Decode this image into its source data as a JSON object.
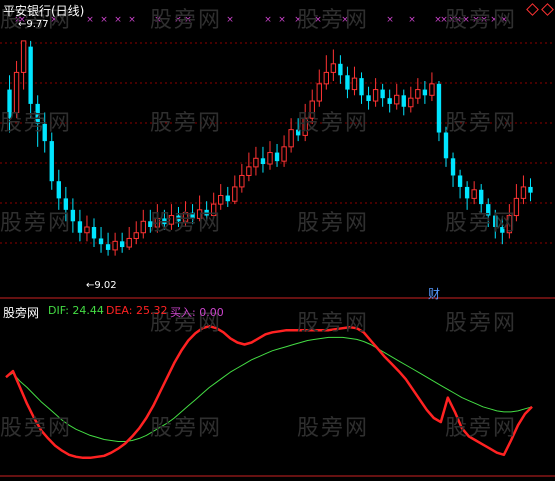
{
  "watermark": "股旁网",
  "main_panel": {
    "title": "平安银行(日线)",
    "high_label": "9.77",
    "low_label": "9.02",
    "event_label": "财",
    "colors": {
      "up": "#ff3333",
      "down": "#00e5ff",
      "grid": "#8b0000",
      "marker": "#cc44cc",
      "text": "#ffffff",
      "event": "#5599ff"
    }
  },
  "indicator_panel": {
    "title": "股旁网",
    "dif_label": "DIF: 24.44",
    "dea_label": "DEA: 25.32",
    "buy_label": "买入: 0.00",
    "colors": {
      "dif": "#44dd44",
      "dea": "#ff2222",
      "buy": "#cc44cc",
      "title": "#ffffff"
    }
  },
  "chart_data": [
    {
      "type": "candlestick",
      "title": "平安银行(日线)",
      "annotations": [
        {
          "text": "9.77",
          "kind": "high"
        },
        {
          "text": "9.02",
          "kind": "low"
        },
        {
          "text": "财",
          "kind": "event"
        }
      ],
      "ylim": [
        8.9,
        9.85
      ],
      "candles": [
        [
          9.6,
          9.5,
          9.65,
          9.45
        ],
        [
          9.52,
          9.66,
          9.7,
          9.5
        ],
        [
          9.66,
          9.77,
          9.77,
          9.6
        ],
        [
          9.75,
          9.55,
          9.77,
          9.5
        ],
        [
          9.55,
          9.48,
          9.58,
          9.4
        ],
        [
          9.48,
          9.42,
          9.52,
          9.38
        ],
        [
          9.42,
          9.28,
          9.45,
          9.25
        ],
        [
          9.28,
          9.22,
          9.32,
          9.18
        ],
        [
          9.22,
          9.18,
          9.26,
          9.14
        ],
        [
          9.18,
          9.14,
          9.22,
          9.1
        ],
        [
          9.14,
          9.1,
          9.18,
          9.07
        ],
        [
          9.1,
          9.12,
          9.16,
          9.07
        ],
        [
          9.12,
          9.08,
          9.15,
          9.05
        ],
        [
          9.08,
          9.06,
          9.12,
          9.03
        ],
        [
          9.06,
          9.04,
          9.1,
          9.02
        ],
        [
          9.04,
          9.07,
          9.1,
          9.02
        ],
        [
          9.07,
          9.05,
          9.1,
          9.03
        ],
        [
          9.05,
          9.08,
          9.12,
          9.04
        ],
        [
          9.08,
          9.1,
          9.14,
          9.06
        ],
        [
          9.1,
          9.14,
          9.18,
          9.08
        ],
        [
          9.14,
          9.12,
          9.18,
          9.1
        ],
        [
          9.12,
          9.15,
          9.2,
          9.1
        ],
        [
          9.15,
          9.13,
          9.18,
          9.11
        ],
        [
          9.13,
          9.16,
          9.2,
          9.11
        ],
        [
          9.16,
          9.14,
          9.19,
          9.12
        ],
        [
          9.14,
          9.17,
          9.21,
          9.12
        ],
        [
          9.17,
          9.15,
          9.2,
          9.13
        ],
        [
          9.15,
          9.18,
          9.23,
          9.14
        ],
        [
          9.18,
          9.16,
          9.21,
          9.14
        ],
        [
          9.16,
          9.2,
          9.24,
          9.15
        ],
        [
          9.2,
          9.23,
          9.27,
          9.18
        ],
        [
          9.23,
          9.21,
          9.26,
          9.19
        ],
        [
          9.21,
          9.26,
          9.3,
          9.2
        ],
        [
          9.26,
          9.3,
          9.34,
          9.24
        ],
        [
          9.3,
          9.33,
          9.38,
          9.28
        ],
        [
          9.33,
          9.36,
          9.4,
          9.3
        ],
        [
          9.36,
          9.34,
          9.4,
          9.31
        ],
        [
          9.34,
          9.38,
          9.42,
          9.32
        ],
        [
          9.38,
          9.35,
          9.41,
          9.33
        ],
        [
          9.35,
          9.4,
          9.44,
          9.33
        ],
        [
          9.4,
          9.46,
          9.5,
          9.38
        ],
        [
          9.46,
          9.44,
          9.5,
          9.42
        ],
        [
          9.44,
          9.5,
          9.55,
          9.42
        ],
        [
          9.5,
          9.56,
          9.6,
          9.48
        ],
        [
          9.56,
          9.62,
          9.67,
          9.54
        ],
        [
          9.62,
          9.66,
          9.72,
          9.6
        ],
        [
          9.66,
          9.69,
          9.74,
          9.63
        ],
        [
          9.69,
          9.65,
          9.72,
          9.62
        ],
        [
          9.65,
          9.6,
          9.68,
          9.57
        ],
        [
          9.6,
          9.64,
          9.68,
          9.58
        ],
        [
          9.64,
          9.58,
          9.66,
          9.55
        ],
        [
          9.58,
          9.56,
          9.61,
          9.53
        ],
        [
          9.56,
          9.6,
          9.64,
          9.54
        ],
        [
          9.6,
          9.57,
          9.62,
          9.54
        ],
        [
          9.57,
          9.55,
          9.6,
          9.52
        ],
        [
          9.55,
          9.58,
          9.62,
          9.53
        ],
        [
          9.58,
          9.54,
          9.6,
          9.51
        ],
        [
          9.54,
          9.57,
          9.61,
          9.52
        ],
        [
          9.57,
          9.6,
          9.64,
          9.55
        ],
        [
          9.6,
          9.58,
          9.63,
          9.55
        ],
        [
          9.58,
          9.62,
          9.66,
          9.56
        ],
        [
          9.62,
          9.45,
          9.63,
          9.42
        ],
        [
          9.45,
          9.36,
          9.47,
          9.33
        ],
        [
          9.36,
          9.3,
          9.38,
          9.26
        ],
        [
          9.3,
          9.26,
          9.32,
          9.22
        ],
        [
          9.26,
          9.22,
          9.28,
          9.18
        ],
        [
          9.22,
          9.25,
          9.28,
          9.2
        ],
        [
          9.25,
          9.2,
          9.27,
          9.17
        ],
        [
          9.2,
          9.16,
          9.22,
          9.12
        ],
        [
          9.16,
          9.12,
          9.18,
          9.08
        ],
        [
          9.12,
          9.1,
          9.15,
          9.06
        ],
        [
          9.1,
          9.16,
          9.2,
          9.08
        ],
        [
          9.16,
          9.22,
          9.27,
          9.14
        ],
        [
          9.22,
          9.26,
          9.3,
          9.2
        ],
        [
          9.26,
          9.24,
          9.29,
          9.21
        ]
      ]
    },
    {
      "type": "line",
      "series": [
        {
          "name": "DIF",
          "values": [
            -8,
            -4,
            -12,
            -18,
            -25,
            -32,
            -38,
            -44,
            -50,
            -55,
            -59,
            -62,
            -65,
            -67,
            -69,
            -70,
            -71,
            -71,
            -70,
            -68,
            -65,
            -61,
            -57,
            -53,
            -48,
            -42,
            -36,
            -30,
            -24,
            -18,
            -13,
            -8,
            -3,
            1,
            5,
            9,
            12,
            15,
            18,
            20,
            22,
            24,
            26,
            28,
            29,
            30,
            31,
            31,
            31,
            30,
            29,
            27,
            24,
            20,
            16,
            12,
            8,
            4,
            0,
            -4,
            -8,
            -12,
            -16,
            -20,
            -24,
            -28,
            -31,
            -34,
            -37,
            -39,
            -41,
            -42,
            -42,
            -41,
            -39,
            -37
          ]
        },
        {
          "name": "DEA",
          "values": [
            -8,
            -2,
            -18,
            -34,
            -48,
            -60,
            -68,
            -75,
            -80,
            -84,
            -86,
            -87,
            -87,
            -86,
            -85,
            -82,
            -78,
            -73,
            -66,
            -58,
            -48,
            -36,
            -22,
            -8,
            6,
            18,
            28,
            35,
            40,
            42,
            40,
            36,
            30,
            26,
            24,
            26,
            30,
            34,
            36,
            37,
            38,
            38,
            38,
            38,
            38,
            38,
            38,
            39,
            40,
            41,
            40,
            36,
            28,
            20,
            12,
            5,
            -2,
            -10,
            -20,
            -30,
            -40,
            -48,
            -52,
            -28,
            -42,
            -58,
            -66,
            -70,
            -74,
            -78,
            -82,
            -84,
            -70,
            -55,
            -44,
            -37
          ]
        }
      ],
      "ylim": [
        -95,
        50
      ]
    }
  ]
}
